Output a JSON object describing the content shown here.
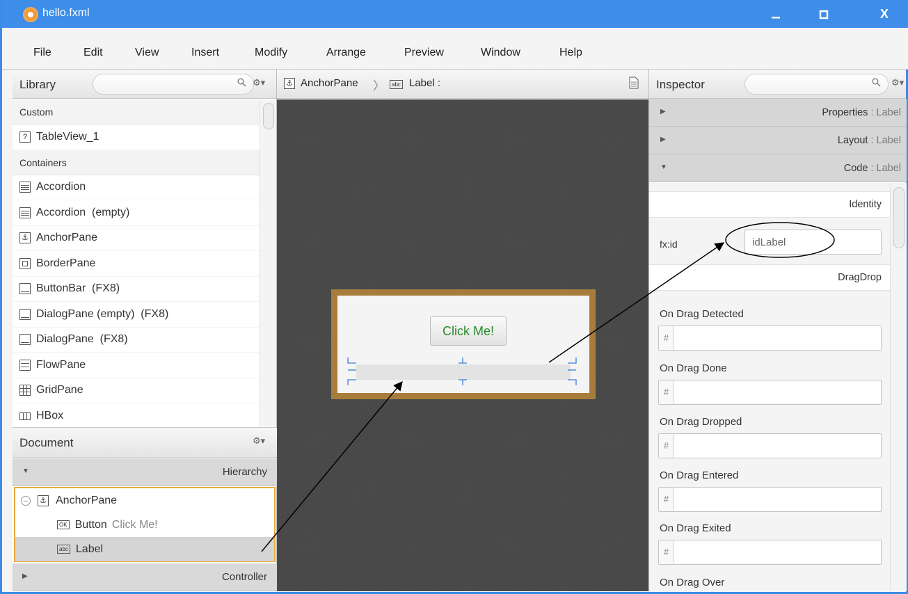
{
  "window": {
    "title": "hello.fxml",
    "minimize": "–",
    "maximize": "□",
    "close": "X"
  },
  "menu": [
    "File",
    "Edit",
    "View",
    "Insert",
    "Modify",
    "Arrange",
    "Preview",
    "Window",
    "Help"
  ],
  "library": {
    "title": "Library",
    "search_icon": "search-icon",
    "groups": [
      {
        "name": "Custom",
        "items": [
          {
            "label": "TableView_1",
            "icon": "question-icon"
          }
        ]
      },
      {
        "name": "Containers",
        "items": [
          {
            "label": "Accordion",
            "icon": "accordion-icon"
          },
          {
            "label": "Accordion  (empty)",
            "icon": "accordion-icon"
          },
          {
            "label": "AnchorPane",
            "icon": "anchorpane-icon"
          },
          {
            "label": "BorderPane",
            "icon": "borderpane-icon"
          },
          {
            "label": "ButtonBar  (FX8)",
            "icon": "buttonbar-icon"
          },
          {
            "label": "DialogPane (empty)  (FX8)",
            "icon": "dialogpane-icon"
          },
          {
            "label": "DialogPane  (FX8)",
            "icon": "dialogpane-icon"
          },
          {
            "label": "FlowPane",
            "icon": "flowpane-icon"
          },
          {
            "label": "GridPane",
            "icon": "gridpane-icon"
          },
          {
            "label": "HBox",
            "icon": "hbox-icon"
          }
        ]
      }
    ]
  },
  "document": {
    "title": "Document",
    "hierarchy_title": "Hierarchy",
    "controller_title": "Controller",
    "tree": {
      "root": "AnchorPane",
      "button_type": "Button",
      "button_text": "Click Me!",
      "label_type": "Label"
    },
    "badges": {
      "ok": "OK",
      "abc": "abc"
    }
  },
  "breadcrumb": {
    "root": "AnchorPane",
    "separator": "〉",
    "current": "Label :"
  },
  "canvas": {
    "button_text": "Click Me!"
  },
  "inspector": {
    "title": "Inspector",
    "sections": [
      {
        "name": "Properties",
        "sub": "Label",
        "arrow": "▶"
      },
      {
        "name": "Layout",
        "sub": "Label",
        "arrow": "▶"
      },
      {
        "name": "Code",
        "sub": "Label",
        "arrow": "▼"
      }
    ],
    "sep": " : ",
    "identity_title": "Identity",
    "fxid_label": "fx:id",
    "fxid_value": "idLabel",
    "dragdrop_title": "DragDrop",
    "hash": "#",
    "events": [
      "On Drag Detected",
      "On Drag Done",
      "On Drag Dropped",
      "On Drag Entered",
      "On Drag Exited",
      "On Drag Over"
    ]
  }
}
